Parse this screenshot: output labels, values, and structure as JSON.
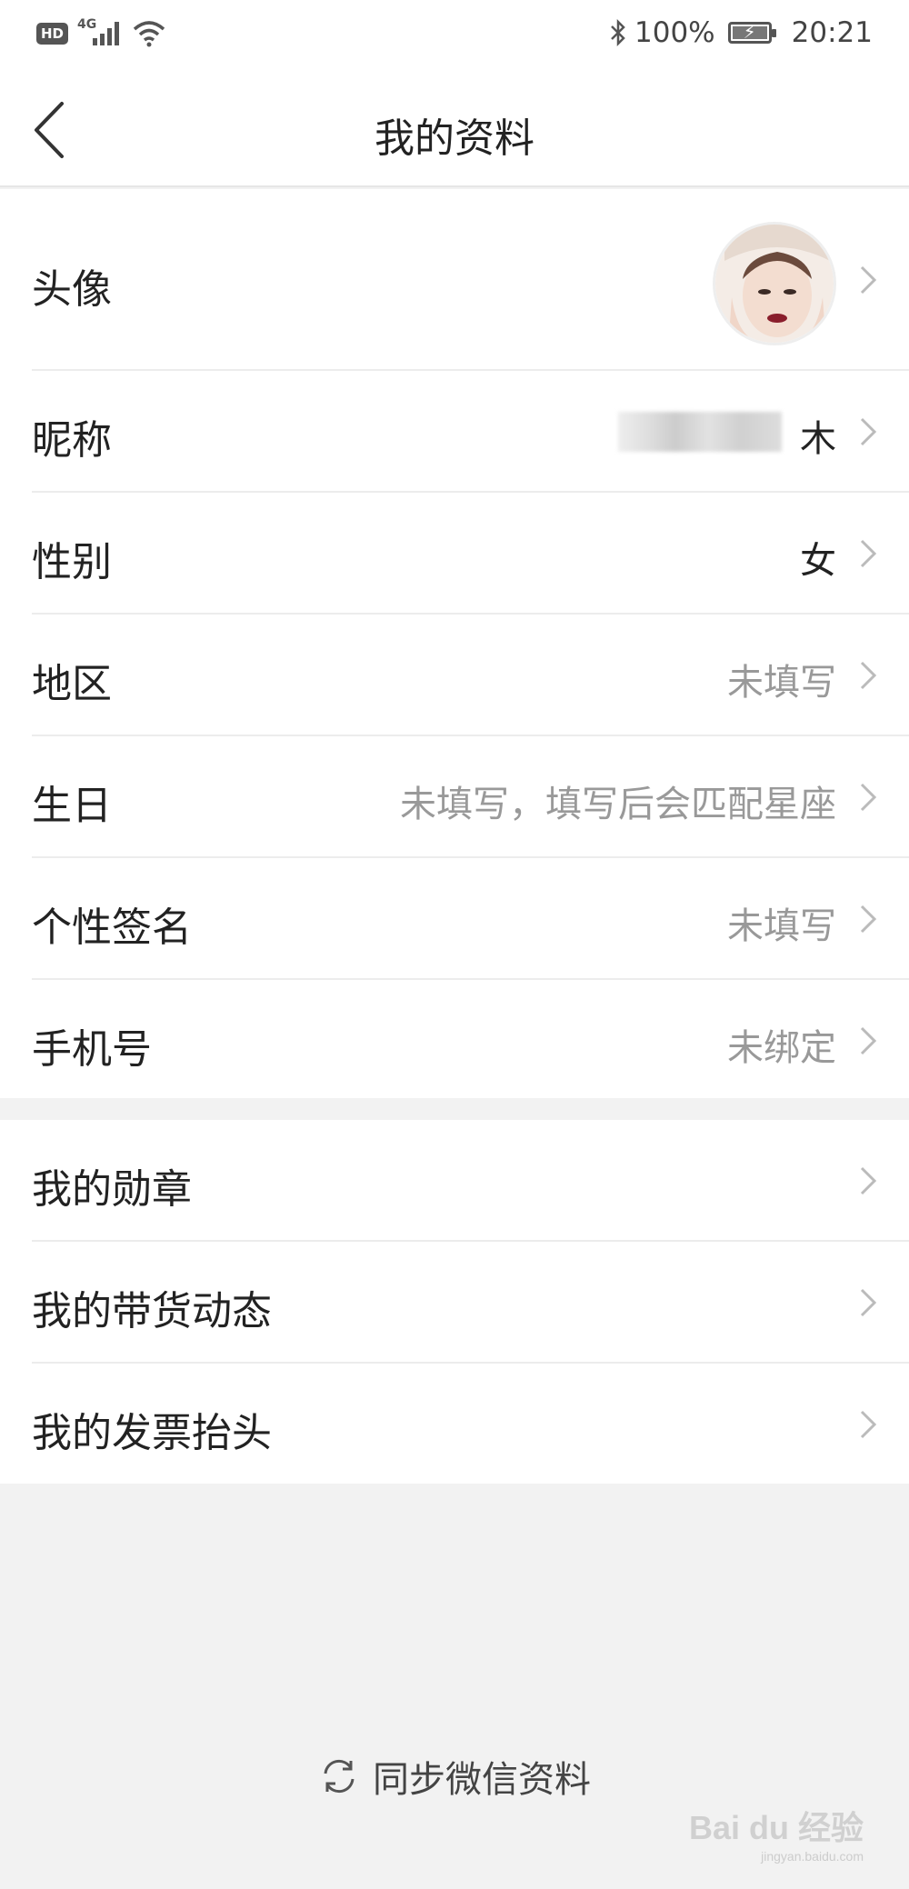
{
  "status_bar": {
    "hd": "HD",
    "network": "4G",
    "battery": "100%",
    "time": "20:21"
  },
  "nav": {
    "title": "我的资料"
  },
  "profile": {
    "avatar_label": "头像",
    "nickname_label": "昵称",
    "nickname_value": "木",
    "gender_label": "性别",
    "gender_value": "女",
    "region_label": "地区",
    "region_value": "未填写",
    "birthday_label": "生日",
    "birthday_value": "未填写，填写后会匹配星座",
    "signature_label": "个性签名",
    "signature_value": "未填写",
    "phone_label": "手机号",
    "phone_value": "未绑定"
  },
  "more": {
    "medals_label": "我的勋章",
    "selling_label": "我的带货动态",
    "invoice_label": "我的发票抬头"
  },
  "sync": {
    "label": "同步微信资料"
  },
  "watermark": {
    "brand": "Bai du 经验",
    "url": "jingyan.baidu.com"
  }
}
